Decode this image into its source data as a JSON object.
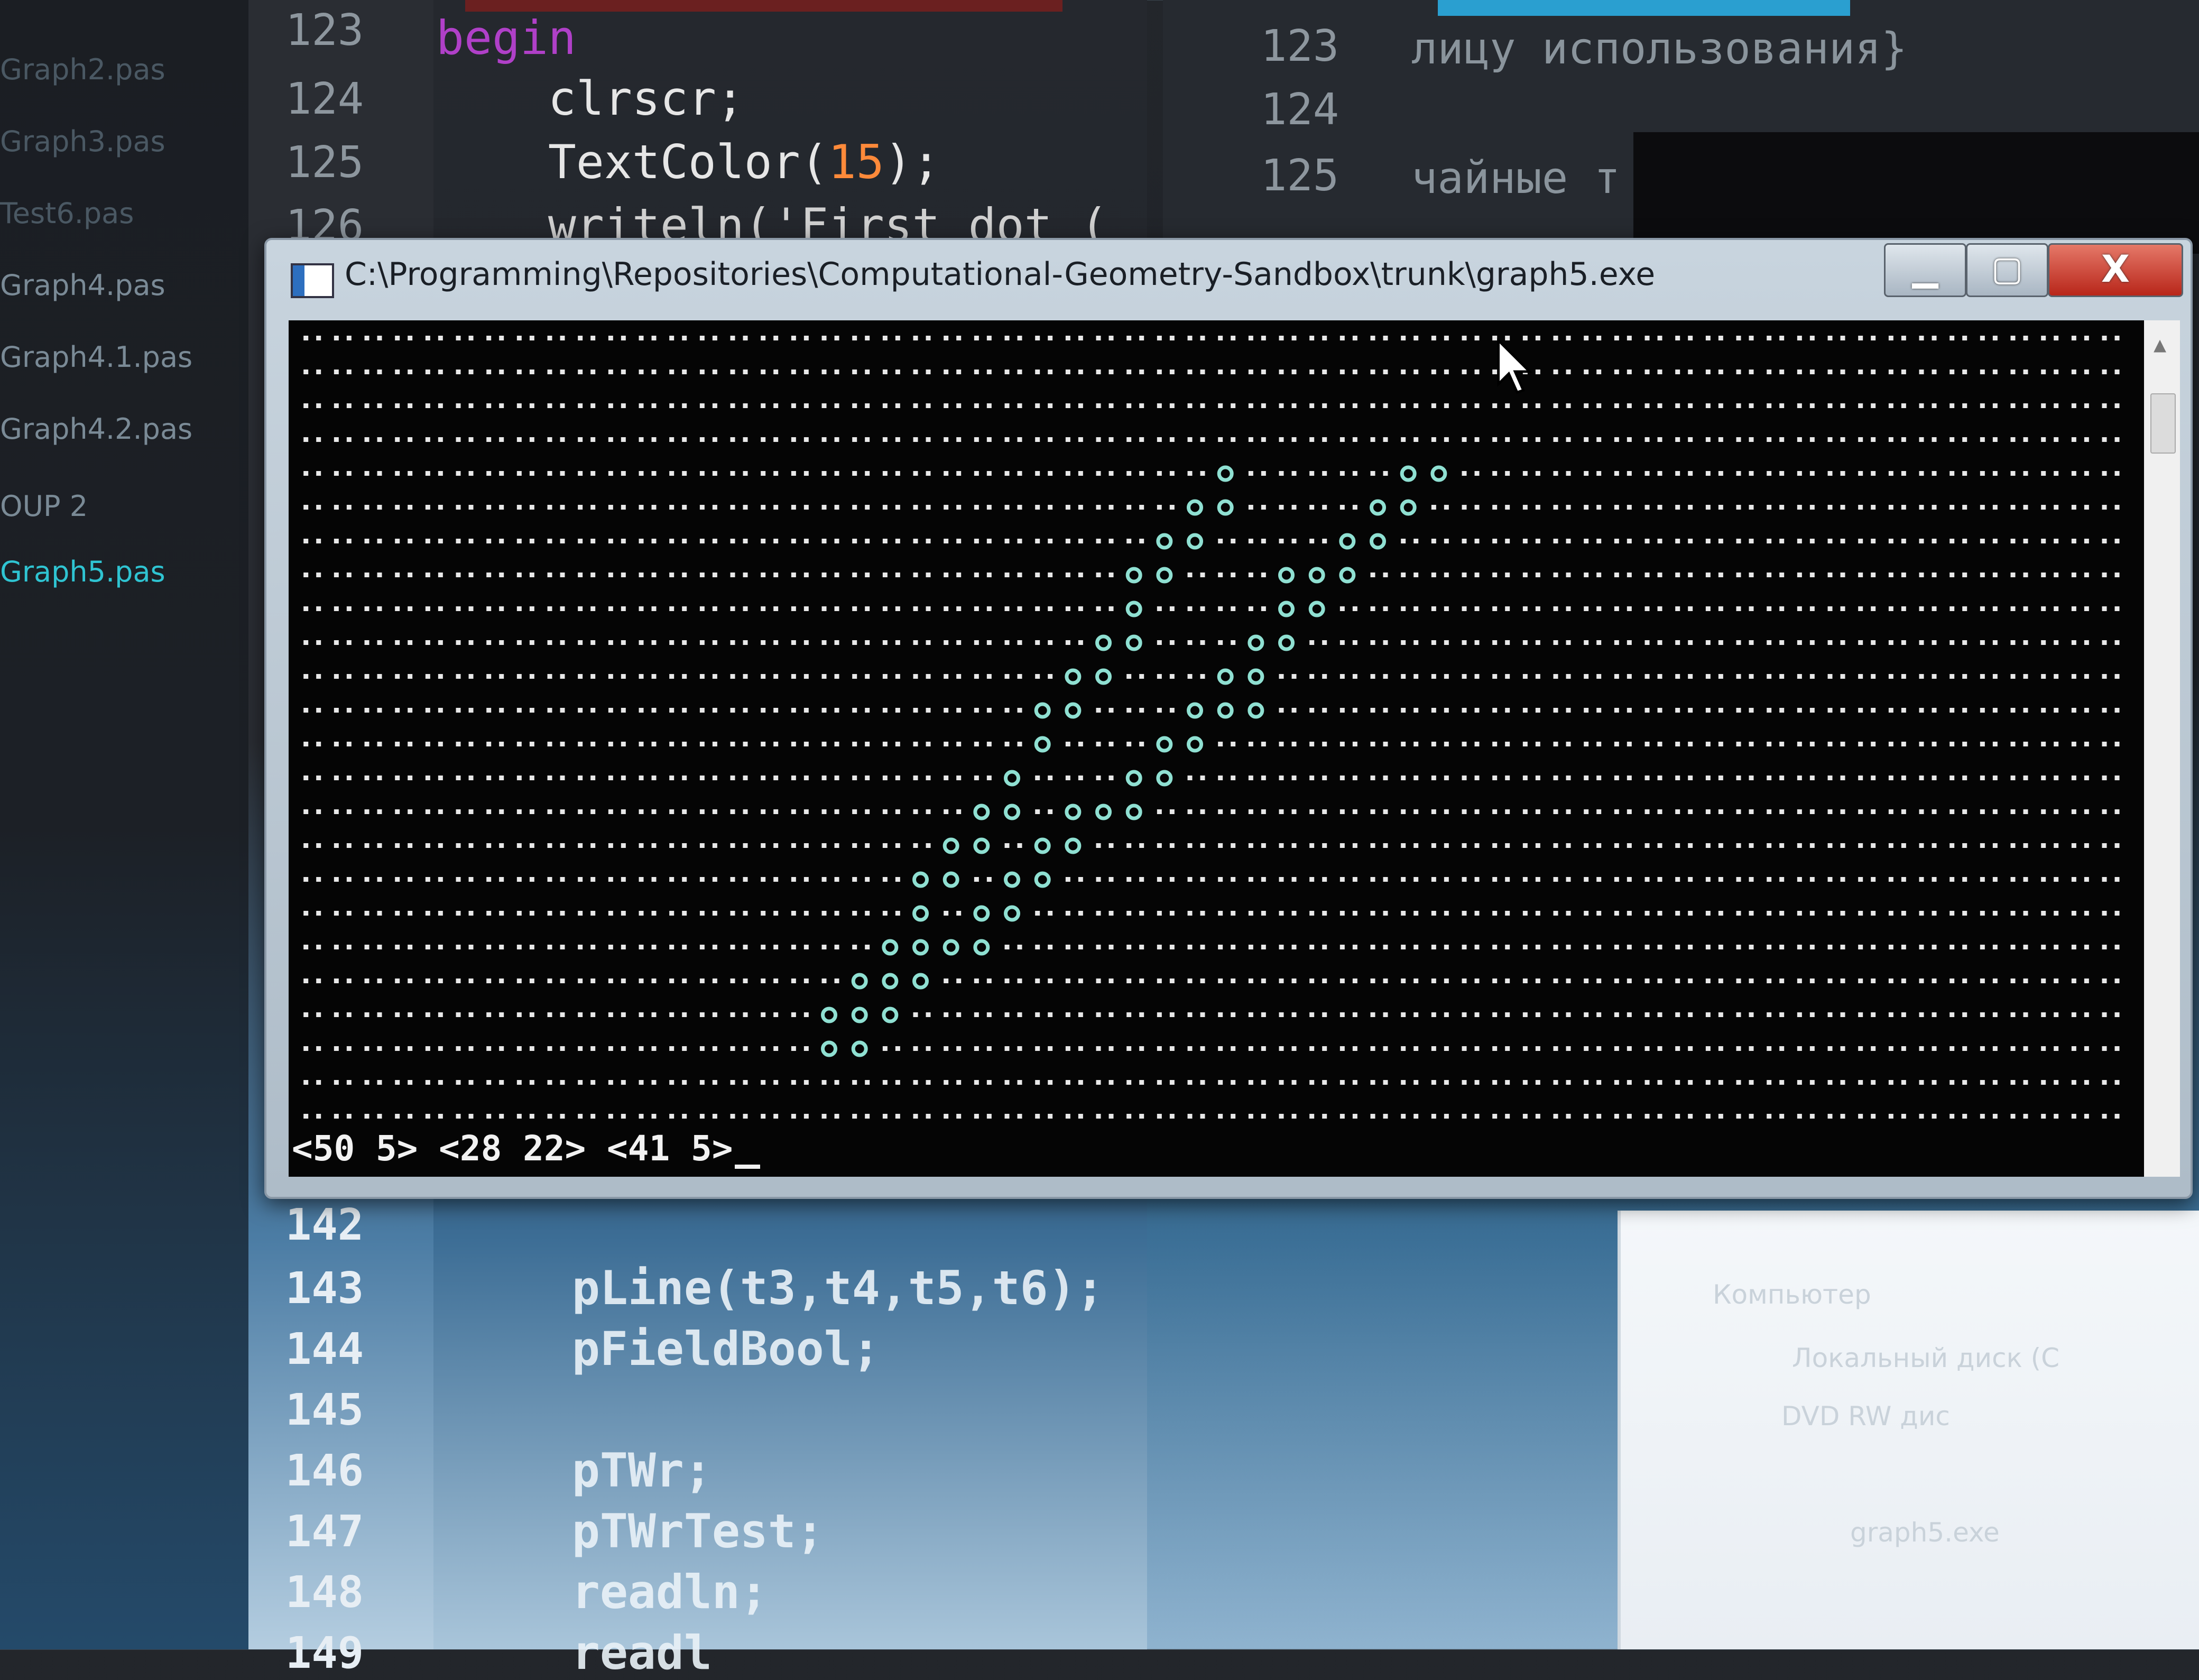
{
  "sidebar": {
    "items": [
      "Graph2.pas",
      "Graph3.pas",
      "Test6.pas",
      "Graph4.pas",
      "Graph4.1.pas",
      "Graph4.2.pas",
      "OUP 2",
      "Graph5.pas"
    ],
    "active": "Graph5.pas"
  },
  "editor_top": {
    "line_numbers": [
      "123",
      "124",
      "125",
      "126"
    ],
    "lines": [
      "begin",
      "    clrscr;",
      "    TextColor(",
      "15",
      ");",
      "    writeln('First dot ("
    ]
  },
  "editor_right": {
    "line_numbers": [
      "123",
      "124",
      "125"
    ],
    "lines": [
      "лицу использования}",
      "",
      "чайные т"
    ]
  },
  "editor_bottom": {
    "line_numbers": [
      "142",
      "143",
      "144",
      "145",
      "146",
      "147",
      "148",
      "149"
    ],
    "lines": [
      "",
      "    pLine(t3,t4,t5,t6);",
      "    pFieldBool;",
      "",
      "    pTWr;",
      "    pTWrTest;",
      "    readln;",
      "    readl"
    ]
  },
  "explorer": {
    "items": [
      "Компьютер",
      "Локальный диск (C",
      "DVD RW дис",
      "graph5.exe"
    ]
  },
  "window": {
    "title": "C:\\Programming\\Repositories\\Computational-Geometry-Sandbox\\trunk\\graph5.exe",
    "minimize_label": "▁",
    "maximize_label": "▢",
    "close_label": "X"
  },
  "console": {
    "cols": 60,
    "rows": 24,
    "dot_char": "•",
    "hit_char": "o",
    "dot_color": "#e8e8e8",
    "hit_color": "#8fe0d2",
    "hits": [
      [
        4,
        30
      ],
      [
        4,
        36
      ],
      [
        4,
        37
      ],
      [
        5,
        29
      ],
      [
        5,
        30
      ],
      [
        5,
        35
      ],
      [
        5,
        36
      ],
      [
        6,
        28
      ],
      [
        6,
        29
      ],
      [
        6,
        34
      ],
      [
        6,
        35
      ],
      [
        7,
        27
      ],
      [
        7,
        28
      ],
      [
        7,
        32
      ],
      [
        7,
        33
      ],
      [
        7,
        34
      ],
      [
        8,
        27
      ],
      [
        8,
        32
      ],
      [
        8,
        33
      ],
      [
        9,
        26
      ],
      [
        9,
        27
      ],
      [
        9,
        31
      ],
      [
        9,
        32
      ],
      [
        10,
        25
      ],
      [
        10,
        26
      ],
      [
        10,
        30
      ],
      [
        10,
        31
      ],
      [
        11,
        24
      ],
      [
        11,
        25
      ],
      [
        11,
        29
      ],
      [
        11,
        30
      ],
      [
        11,
        31
      ],
      [
        12,
        24
      ],
      [
        12,
        28
      ],
      [
        12,
        29
      ],
      [
        13,
        23
      ],
      [
        13,
        27
      ],
      [
        13,
        28
      ],
      [
        14,
        22
      ],
      [
        14,
        23
      ],
      [
        14,
        25
      ],
      [
        14,
        26
      ],
      [
        14,
        27
      ],
      [
        15,
        21
      ],
      [
        15,
        22
      ],
      [
        15,
        24
      ],
      [
        15,
        25
      ],
      [
        16,
        20
      ],
      [
        16,
        21
      ],
      [
        16,
        23
      ],
      [
        16,
        24
      ],
      [
        17,
        20
      ],
      [
        17,
        22
      ],
      [
        17,
        23
      ],
      [
        18,
        19
      ],
      [
        18,
        20
      ],
      [
        18,
        21
      ],
      [
        18,
        22
      ],
      [
        19,
        18
      ],
      [
        19,
        19
      ],
      [
        19,
        20
      ],
      [
        20,
        17
      ],
      [
        20,
        18
      ],
      [
        20,
        19
      ],
      [
        21,
        17
      ],
      [
        21,
        18
      ]
    ],
    "status_text": "<50 5> <28 22> <41 5>"
  }
}
